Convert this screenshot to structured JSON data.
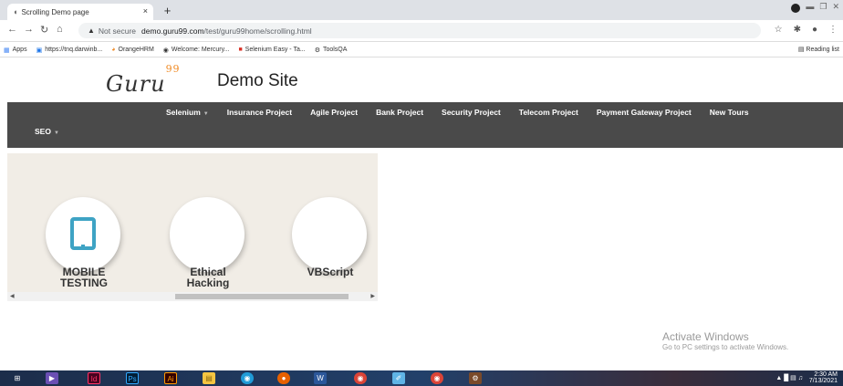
{
  "browser": {
    "tab_title": "Scrolling Demo page",
    "tab_close": "×",
    "new_tab": "+",
    "not_secure": "Not secure",
    "url_host": "demo.guru99.com",
    "url_path": "/test/guru99home/scrolling.html"
  },
  "bookmarks": {
    "items": [
      {
        "label": "Apps"
      },
      {
        "label": "https://tnq.darwinb..."
      },
      {
        "label": "OrangeHRM"
      },
      {
        "label": "Welcome: Mercury..."
      },
      {
        "label": "Selenium Easy - Ta..."
      },
      {
        "label": "ToolsQA"
      }
    ],
    "reading_list": "Reading list"
  },
  "site": {
    "logo_text": "Guru",
    "logo_sup": "99",
    "title": "Demo Site"
  },
  "menu": {
    "items": [
      {
        "label": "Selenium"
      },
      {
        "label": "Insurance Project"
      },
      {
        "label": "Agile Project"
      },
      {
        "label": "Bank Project"
      },
      {
        "label": "Security Project"
      },
      {
        "label": "Telecom Project"
      },
      {
        "label": "Payment Gateway Project"
      },
      {
        "label": "New Tours"
      }
    ],
    "seo": "SEO"
  },
  "courses": [
    {
      "line1": "MOBILE",
      "line2": "TESTING"
    },
    {
      "line1": "Ethical",
      "line2": "Hacking"
    },
    {
      "line1": "VBScript",
      "line2": ""
    }
  ],
  "watermark": {
    "line1": "Activate Windows",
    "line2": "Go to PC settings to activate Windows."
  },
  "taskbar": {
    "time": "2:30 AM",
    "date": "7/13/2021"
  }
}
